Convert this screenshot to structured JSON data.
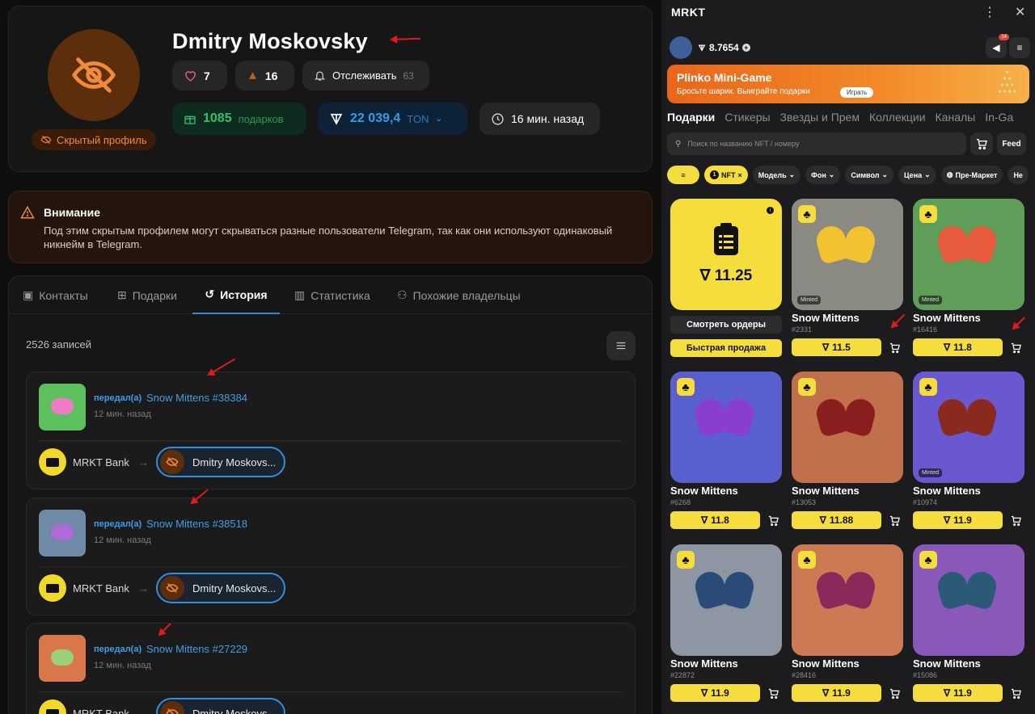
{
  "profile": {
    "name": "Dmitry Moskovsky",
    "hidden_label": "Скрытый профиль",
    "likes": "7",
    "dislikes": "16",
    "follow_label": "Отслеживать",
    "follow_count": "63",
    "gifts_count": "1085",
    "gifts_label": "подарков",
    "ton_value": "22 039,4",
    "ton_label": "TON",
    "last_seen": "16 мин. назад"
  },
  "warning": {
    "title": "Внимание",
    "text": "Под этим скрытым профилем могут скрываться разные пользователи Telegram, так как они используют одинаковый никнейм в Telegram."
  },
  "tabs": [
    {
      "label": "Контакты"
    },
    {
      "label": "Подарки"
    },
    {
      "label": "История"
    },
    {
      "label": "Статистика"
    },
    {
      "label": "Похожие владельцы"
    }
  ],
  "history": {
    "count_label": "2526 записей",
    "entries": [
      {
        "action": "передал(а)",
        "gift": "Snow Mittens #38384",
        "time": "12 мин. назад",
        "from": "MRKT Bank",
        "to": "Dmitry Moskovs...",
        "thumb_color": "#5cc05c"
      },
      {
        "action": "передал(а)",
        "gift": "Snow Mittens #38518",
        "time": "12 мин. назад",
        "from": "MRKT Bank",
        "to": "Dmitry Moskovs...",
        "thumb_color": "#6f8aa6"
      },
      {
        "action": "передал(а)",
        "gift": "Snow Mittens #27229",
        "time": "12 мин. назад",
        "from": "MRKT Bank",
        "to": "Dmitry Moskovs...",
        "thumb_color": "#d9764a"
      }
    ]
  },
  "market": {
    "app_title": "MRKT",
    "balance": "8.7654",
    "notif_badge": "14",
    "banner_title": "Plinko Mini-Game",
    "banner_sub": "Бросьте шарик. Выиграйте подарки",
    "banner_play": "Играть",
    "cat_tabs": [
      "Подарки",
      "Стикеры",
      "Звезды и Прем",
      "Коллекции",
      "Каналы",
      "In-Ga"
    ],
    "search_placeholder": "Поиск по названию NFT / номеру",
    "feed_label": "Feed",
    "filters": [
      "NFT",
      "Модель",
      "Фон",
      "Символ",
      "Цена",
      "Пре-Маркет",
      "Не"
    ],
    "nft_count": "1",
    "order_price": "11.25",
    "view_orders": "Смотреть ордеры",
    "quick_sell": "Быстрая продажа",
    "minted_label": "Minted",
    "items": [
      {
        "name": "Snow Mittens",
        "num": "#2331",
        "price": "11.5",
        "bg": "#8a8a82",
        "mitten": "#f2c230",
        "minted": true
      },
      {
        "name": "Snow Mittens",
        "num": "#16416",
        "price": "11.8",
        "bg": "#5f9e58",
        "mitten": "#e85a3c",
        "minted": true
      },
      {
        "name": "Snow Mittens",
        "num": "#6268",
        "price": "11.8",
        "bg": "#5a5fd0",
        "mitten": "#8a3ed0",
        "minted": false
      },
      {
        "name": "Snow Mittens",
        "num": "#13053",
        "price": "11.88",
        "bg": "#c0704a",
        "mitten": "#8a1e1e",
        "minted": false
      },
      {
        "name": "Snow Mittens",
        "num": "#10974",
        "price": "11.9",
        "bg": "#6a58d0",
        "mitten": "#8a2a1e",
        "minted": true
      },
      {
        "name": "Snow Mittens",
        "num": "#22872",
        "price": "11.9",
        "bg": "#8e95a3",
        "mitten": "#2a4a78",
        "minted": false
      },
      {
        "name": "Snow Mittens",
        "num": "#28416",
        "price": "11.9",
        "bg": "#cc7a54",
        "mitten": "#8a2a5a",
        "minted": false
      },
      {
        "name": "Snow Mittens",
        "num": "#15086",
        "price": "11.9",
        "bg": "#8a58b8",
        "mitten": "#2a5a78",
        "minted": false
      }
    ]
  }
}
